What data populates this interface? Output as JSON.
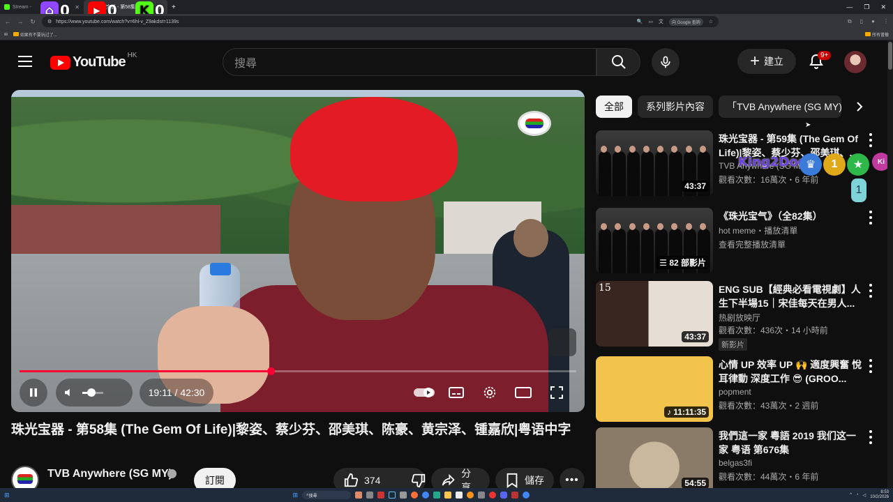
{
  "browser": {
    "tabs": [
      {
        "label": "Stream - ",
        "icon": "kick-icon",
        "color": "#53fc18",
        "active": false
      },
      {
        "label": "珠光宝器 - 第58集 (Th",
        "icon": "youtube-icon",
        "color": "#ff0000",
        "active": true
      }
    ],
    "overlay_counters": [
      {
        "platform": "twitch",
        "value": "0",
        "color": "#9146ff",
        "glyph": "t"
      },
      {
        "platform": "youtube",
        "value": "0",
        "color": "#ff0000",
        "glyph": "▶"
      },
      {
        "platform": "kick",
        "value": "0",
        "color": "#53fc18",
        "glyph": "K"
      }
    ],
    "url": "https://www.youtube.com/watch?v=6hl-v_Z9akdst=1139s",
    "google_button": "向 Google 查詢",
    "bookmark": "如果有不要玩过了...",
    "bookmark_right": "所有書籤"
  },
  "header": {
    "logo_text": "YouTube",
    "region": "HK",
    "search_placeholder": "搜尋",
    "create_label": "建立",
    "notifications_badge": "9+"
  },
  "player": {
    "time_current": "19:11",
    "time_separator": " / ",
    "time_total": "42:30",
    "progress": 0.451,
    "volume": 0.3
  },
  "video": {
    "title": "珠光宝器 - 第58集 (The Gem Of Life)|黎姿、蔡少芬、邵美琪、陈豪、黄宗泽、锺嘉欣|粤语中字",
    "channel": "TVB Anywhere (SG MY)",
    "subscribers": "",
    "subscribe_label": "訂閱",
    "likes": "374",
    "share_label": "分享",
    "save_label": "儲存"
  },
  "chips": [
    {
      "label": "全部",
      "active": true
    },
    {
      "label": "系列影片內容",
      "active": false
    },
    {
      "label": "「TVB Anywhere (SG MY)",
      "active": false
    }
  ],
  "recommendations": [
    {
      "title": "珠光宝器 - 第59集 (The Gem Of Life)|黎姿、蔡少芬、邵美琪、...",
      "channel": "TVB Anywhere (SG MY)",
      "meta": "觀看次數：16萬次・6 年前",
      "duration": "43:37",
      "thumb": "cast",
      "new": ""
    },
    {
      "title": "《珠光宝气》（全82集）",
      "channel": "hot meme・播放清單",
      "meta": "查看完整播放清單",
      "duration": "82 部影片",
      "thumb": "cast",
      "new": ""
    },
    {
      "title": "ENG SUB【經典必看電視劇】人生下半場15｜宋佳每天在男人...",
      "channel": "热剧放映厅",
      "meta": "觀看次數：436次・14 小時前",
      "duration": "43:37",
      "thumb": "drama",
      "new": "新影片"
    },
    {
      "title": "心情 UP 效率 UP 🙌 適度興奮 悅耳律動 深度工作 😎 (GROO...",
      "channel": "popment",
      "meta": "觀看次數：43萬次・2 週前",
      "duration": "11:11:35",
      "thumb": "yellow",
      "new": ""
    },
    {
      "title": "我們這一家 粵語 2019 我们这一家 粤语 第676集",
      "channel": "belgas3fi",
      "meta": "觀看次數：44萬次・6 年前",
      "duration": "54:55",
      "thumb": "food",
      "new": ""
    }
  ],
  "stream_overlay": {
    "username": "King2Dog",
    "count": "1",
    "badge_text": "Ki"
  },
  "taskbar": {
    "search_label": "搜尋",
    "time": "8:53",
    "date": "10/2/2026"
  }
}
